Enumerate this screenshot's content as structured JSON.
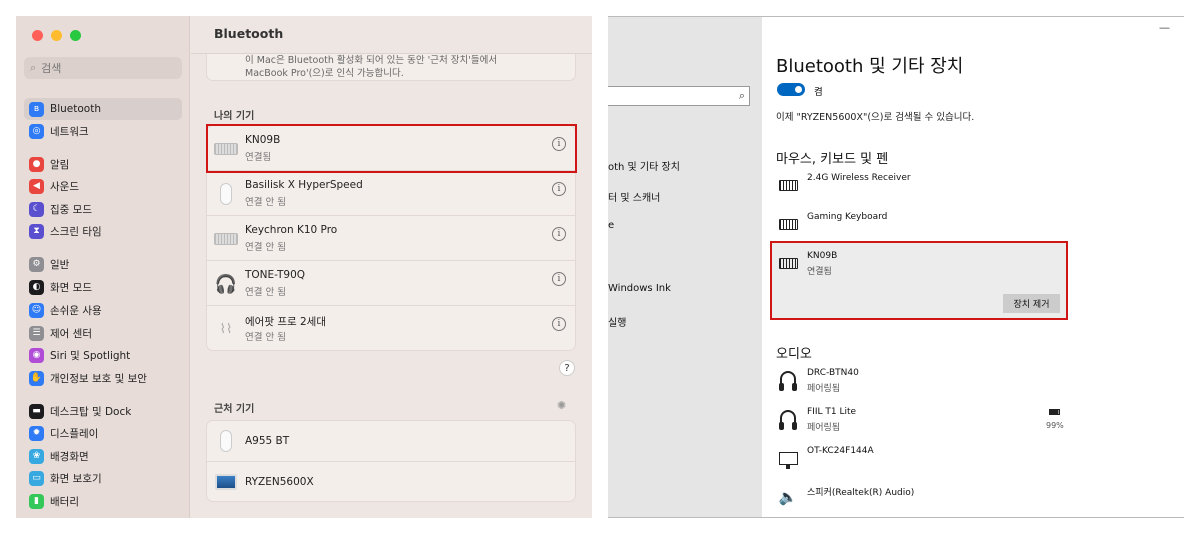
{
  "mac": {
    "search_placeholder": "검색",
    "sidebar": [
      {
        "label": "Bluetooth",
        "color": "#2f7bf5",
        "glyph": "ʙ",
        "selected": true
      },
      {
        "label": "네트워크",
        "color": "#2f7bf5",
        "glyph": "◎"
      },
      {
        "label": "알림",
        "color": "#e8463f",
        "glyph": "●"
      },
      {
        "label": "사운드",
        "color": "#e8463f",
        "glyph": "◀"
      },
      {
        "label": "집중 모드",
        "color": "#5a4fcf",
        "glyph": "☾"
      },
      {
        "label": "스크린 타임",
        "color": "#5a4fcf",
        "glyph": "⧗"
      },
      {
        "label": "일반",
        "color": "#8e8e93",
        "glyph": "⚙"
      },
      {
        "label": "화면 모드",
        "color": "#1c1c1e",
        "glyph": "◐"
      },
      {
        "label": "손쉬운 사용",
        "color": "#2f7bf5",
        "glyph": "☺"
      },
      {
        "label": "제어 센터",
        "color": "#8e8e93",
        "glyph": "☰"
      },
      {
        "label": "Siri 및 Spotlight",
        "color": "#b04cd6",
        "glyph": "◉"
      },
      {
        "label": "개인정보 보호 및 보안",
        "color": "#2f7bf5",
        "glyph": "✋"
      },
      {
        "label": "데스크탑 및 Dock",
        "color": "#1c1c1e",
        "glyph": "▬"
      },
      {
        "label": "디스플레이",
        "color": "#2f7bf5",
        "glyph": "✹"
      },
      {
        "label": "배경화면",
        "color": "#37a8e0",
        "glyph": "❀"
      },
      {
        "label": "화면 보호기",
        "color": "#37a8e0",
        "glyph": "▭"
      },
      {
        "label": "배터리",
        "color": "#34c759",
        "glyph": "▮"
      }
    ],
    "title": "Bluetooth",
    "top_note_line1": "이 Mac은 Bluetooth 활성화 되어 있는 동안 '근처 장치'들에서",
    "top_note_line2": "MacBook Pro'(으)로 인식 가능합니다.",
    "my_devices_header": "나의 기기",
    "my_devices": [
      {
        "name": "KN09B",
        "status": "연결됨",
        "icon": "keyboard-icon"
      },
      {
        "name": "Basilisk X HyperSpeed",
        "status": "연결 안 됨",
        "icon": "mouse-icon"
      },
      {
        "name": "Keychron K10 Pro",
        "status": "연결 안 됨",
        "icon": "keyboard-icon"
      },
      {
        "name": "TONE-T90Q",
        "status": "연결 안 됨",
        "icon": "headphones-icon"
      },
      {
        "name": "에어팟 프로 2세대",
        "status": "연결 안 됨",
        "icon": "airpods-icon"
      }
    ],
    "help_label": "?",
    "nearby_header": "근처 기기",
    "nearby_devices": [
      {
        "name": "A955 BT",
        "icon": "mouse-icon"
      },
      {
        "name": "RYZEN5600X",
        "icon": "monitor-icon"
      }
    ]
  },
  "win": {
    "nav": [
      "oth 및 기타 장치",
      "터 및 스캐너",
      "e",
      "Windows Ink",
      "실행"
    ],
    "title": "Bluetooth 및 기타 장치",
    "toggle_label": "켬",
    "discover_text": "이제 \"RYZEN5600X\"(으)로 검색될 수 있습니다.",
    "section_input": "마우스, 키보드 및 펜",
    "input_devices": [
      {
        "name": "2.4G Wireless Receiver",
        "status": ""
      },
      {
        "name": "Gaming Keyboard",
        "status": ""
      },
      {
        "name": "KN09B",
        "status": "연결됨"
      }
    ],
    "remove_label": "장치 제거",
    "section_audio": "오디오",
    "audio_devices": [
      {
        "name": "DRC-BTN40",
        "status": "페어링됨",
        "icon": "headset-icon"
      },
      {
        "name": "FIIL T1 Lite",
        "status": "페어링됨",
        "icon": "headset-icon",
        "battery": "99%"
      },
      {
        "name": "OT-KC24F144A",
        "status": "",
        "icon": "monitor-icon"
      },
      {
        "name": "스피커(Realtek(R) Audio)",
        "status": "",
        "icon": "speaker-icon"
      }
    ]
  }
}
